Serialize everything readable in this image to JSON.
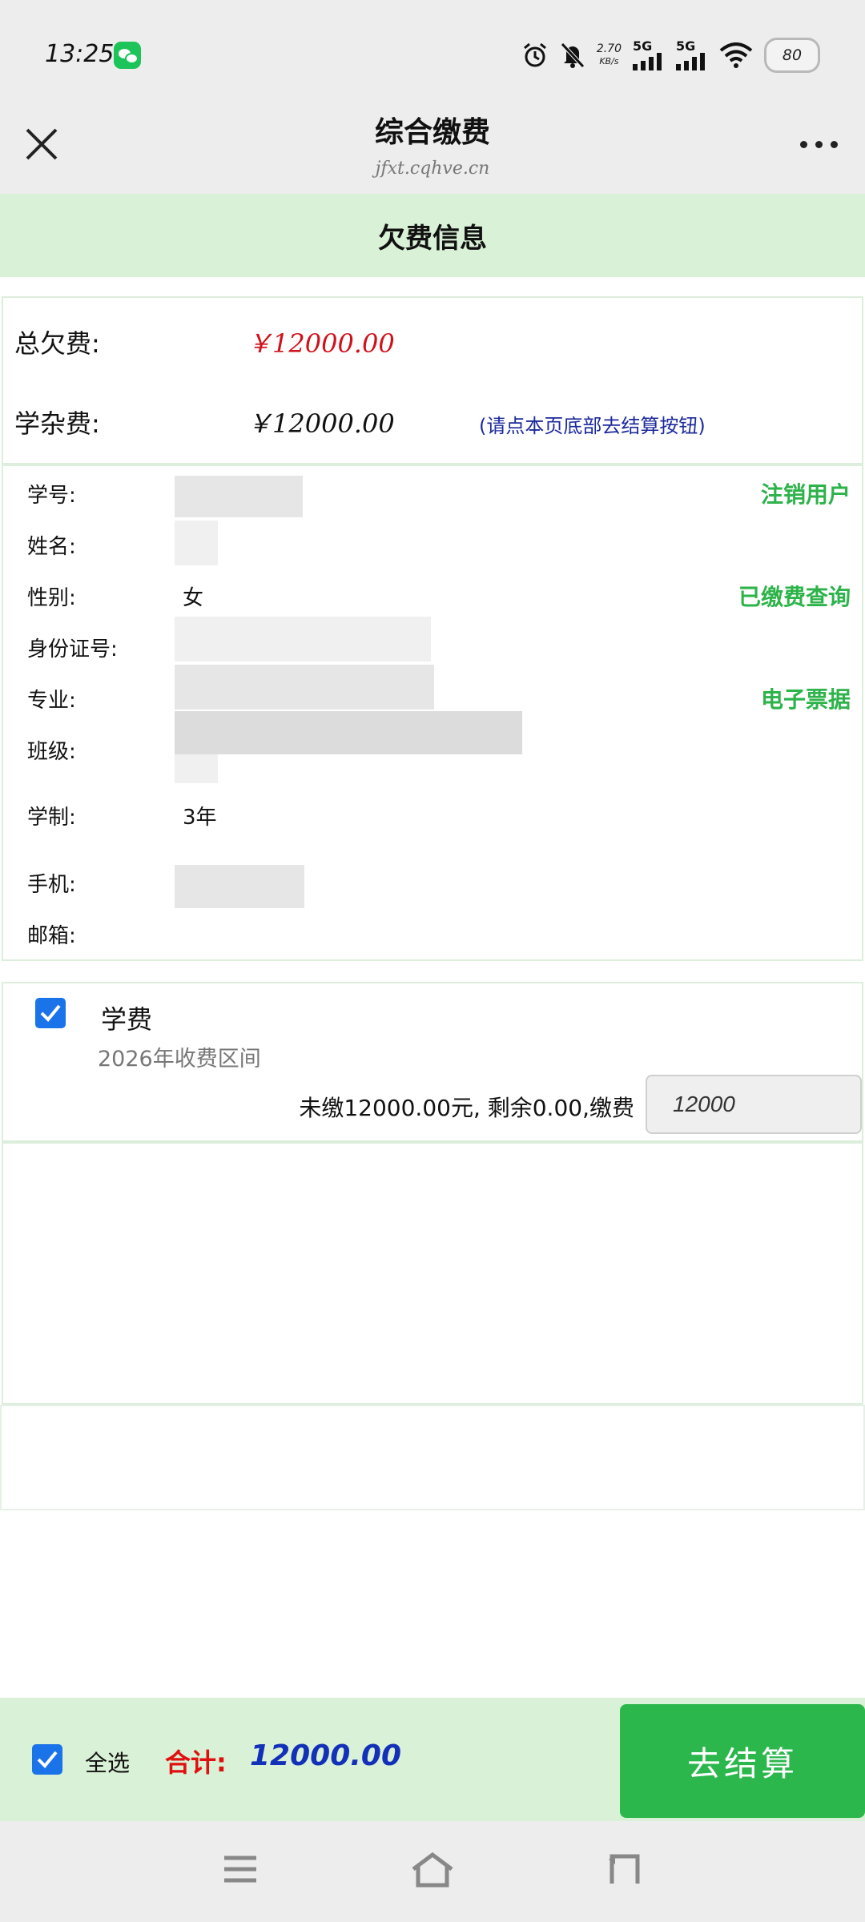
{
  "status_bar": {
    "time": "13:25",
    "speed_value": "2.70",
    "speed_unit": "KB/s",
    "sim1": "5G",
    "sim2": "5G",
    "battery": "80",
    "icons": [
      "wechat-icon",
      "alarm-icon",
      "mute-icon",
      "signal-icon",
      "wifi-icon",
      "battery-icon"
    ]
  },
  "header": {
    "title": "综合缴费",
    "url": "jfxt.cqhve.cn"
  },
  "section_title": "欠费信息",
  "summary": {
    "total_label": "总欠费:",
    "total_value": "￥12000.00",
    "misc_label": "学杂费:",
    "misc_value": "￥12000.00",
    "note": "(请点本页底部去结算按钮)"
  },
  "student": {
    "id_label": "学号:",
    "name_label": "姓名:",
    "gender_label": "性别:",
    "gender_value": "女",
    "idcard_label": "身份证号:",
    "major_label": "专业:",
    "class_label": "班级:",
    "duration_label": "学制:",
    "duration_value": "3年",
    "phone_label": "手机:",
    "email_label": "邮箱:"
  },
  "side_links": {
    "logout": "注销用户",
    "paid_query": "已缴费查询",
    "e_receipt": "电子票据"
  },
  "fee_item": {
    "checked": true,
    "name": "学费",
    "period": "2026年收费区间",
    "detail": "未缴12000.00元, 剩余0.00,缴费",
    "amount_value": "12000"
  },
  "bottom_bar": {
    "select_all_checked": true,
    "select_all": "全选",
    "total_label": "合计:",
    "total_value": "12000.00",
    "checkout": "去结算"
  },
  "colors": {
    "accent_green": "#2bb74c",
    "header_green": "#d9f1d6",
    "amount_red": "#d0101a",
    "total_blue": "#1330b8",
    "note_blue": "#1c2a9c",
    "checkbox_blue": "#1a73e8"
  }
}
